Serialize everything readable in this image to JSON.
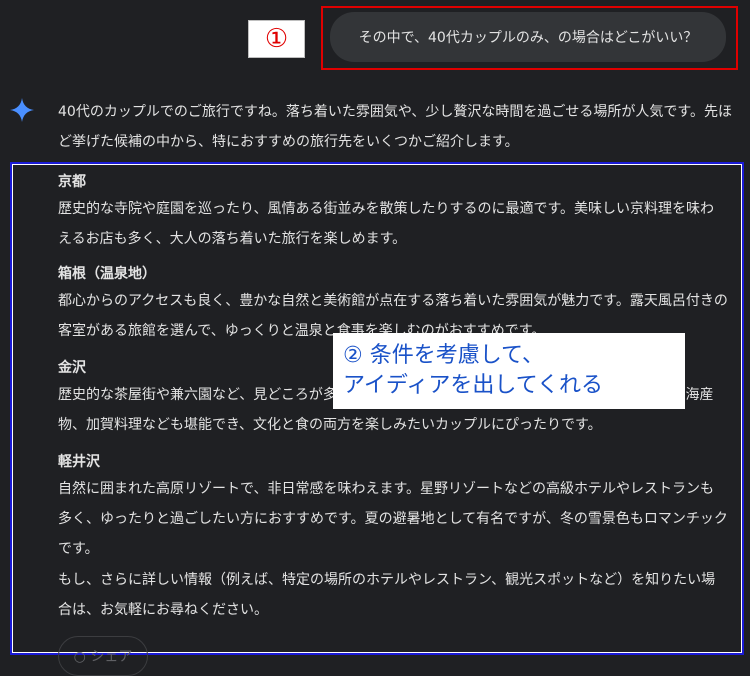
{
  "user_prompt": "その中で、40代カップルのみ、の場合はどこがいい？",
  "callout_1": "①",
  "intro": "40代のカップルでのご旅行ですね。落ち着いた雰囲気や、少し贅沢な時間を過ごせる場所が人気です。先ほど挙げた候補の中から、特におすすめの旅行先をいくつかご紹介します。",
  "sections": [
    {
      "title": "京都",
      "body": "歴史的な寺院や庭園を巡ったり、風情ある街並みを散策したりするのに最適です。美味しい京料理を味わえるお店も多く、大人の落ち着いた旅行を楽しめます。"
    },
    {
      "title": "箱根（温泉地）",
      "body": "都心からのアクセスも良く、豊かな自然と美術館が点在する落ち着いた雰囲気が魅力です。露天風呂付きの客室がある旅館を選んで、ゆっくりと温泉と食事を楽しむのがおすすめです。"
    },
    {
      "title": "金沢",
      "body": "歴史的な茶屋街や兼六園など、見どころが多く、美しい伝統工芸品に触れることができます。新鮮な海産物、加賀料理なども堪能でき、文化と食の両方を楽しみたいカップルにぴったりです。"
    },
    {
      "title": "軽井沢",
      "body": "自然に囲まれた高原リゾートで、非日常感を味わえます。星野リゾートなどの高級ホテルやレストランも多く、ゆったりと過ごしたい方におすすめです。夏の避暑地として有名ですが、冬の雪景色もロマンチックです。"
    }
  ],
  "closing": "もし、さらに詳しい情報（例えば、特定の場所のホテルやレストラン、観光スポットなど）を知りたい場合は、お気軽にお尋ねください。",
  "callout_2": {
    "line1": "② 条件を考慮して、",
    "line2": "アイディアを出してくれる"
  },
  "ghost_chip": "○ シェア",
  "colors": {
    "accent_red": "#e00000",
    "accent_blue": "#1a1ad6",
    "sparkle": "#4a8fff",
    "callout_text": "#1a52c8"
  }
}
